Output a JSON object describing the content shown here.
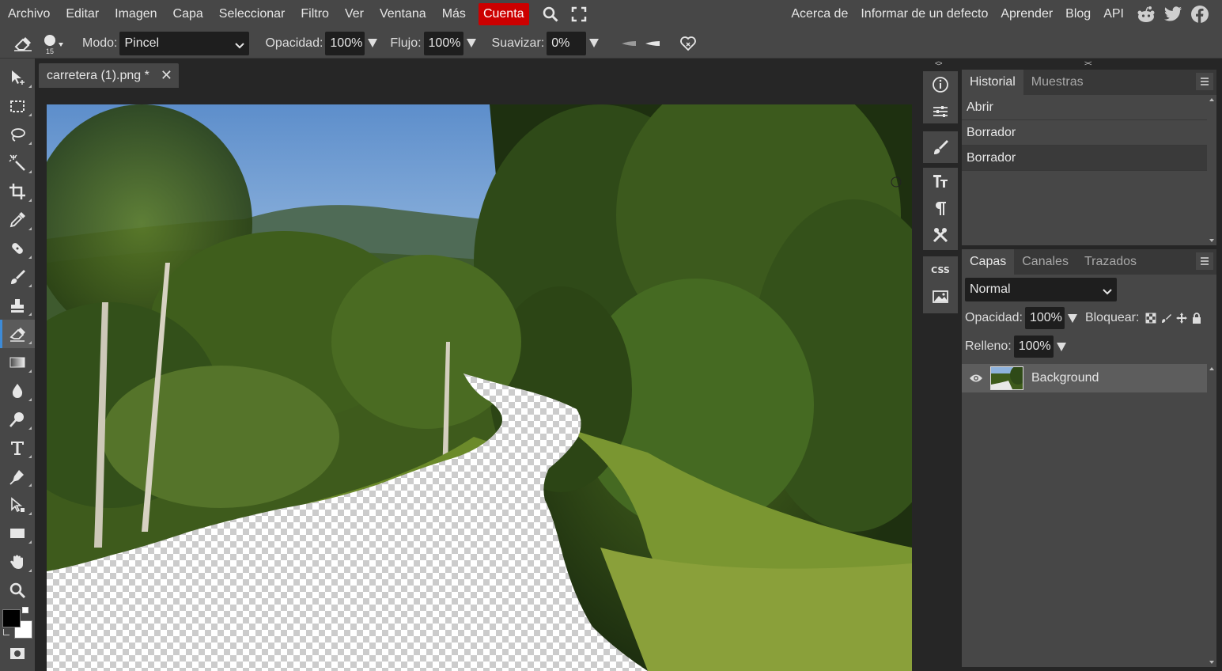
{
  "menu": {
    "items": [
      "Archivo",
      "Editar",
      "Imagen",
      "Capa",
      "Seleccionar",
      "Filtro",
      "Ver",
      "Ventana",
      "Más"
    ],
    "account": "Cuenta",
    "right_items": [
      "Acerca de",
      "Informar de un defecto",
      "Aprender",
      "Blog",
      "API"
    ],
    "icons": [
      "search-icon",
      "fullscreen-icon",
      "reddit-icon",
      "twitter-icon",
      "facebook-icon"
    ]
  },
  "options": {
    "brush_size": "15",
    "mode_label": "Modo:",
    "mode_value": "Pincel",
    "opacity_label": "Opacidad:",
    "opacity_value": "100%",
    "flow_label": "Flujo:",
    "flow_value": "100%",
    "smooth_label": "Suavizar:",
    "smooth_value": "0%"
  },
  "document": {
    "tab_title": "carretera (1).png *"
  },
  "tools": {
    "active": "eraser-tool"
  },
  "history_panel": {
    "tabs": [
      "Historial",
      "Muestras"
    ],
    "items": [
      "Abrir",
      "Borrador",
      "Borrador"
    ]
  },
  "layers_panel": {
    "tabs": [
      "Capas",
      "Canales",
      "Trazados"
    ],
    "blend_mode": "Normal",
    "opacity_label": "Opacidad:",
    "opacity_value": "100%",
    "lock_label": "Bloquear:",
    "fill_label": "Relleno:",
    "fill_value": "100%",
    "layers": [
      {
        "name": "Background",
        "visible": true
      }
    ]
  },
  "colors": {
    "accent": "#cc0000",
    "active_tool": "#3d8bd8",
    "foreground": "#000000",
    "background": "#ffffff"
  }
}
